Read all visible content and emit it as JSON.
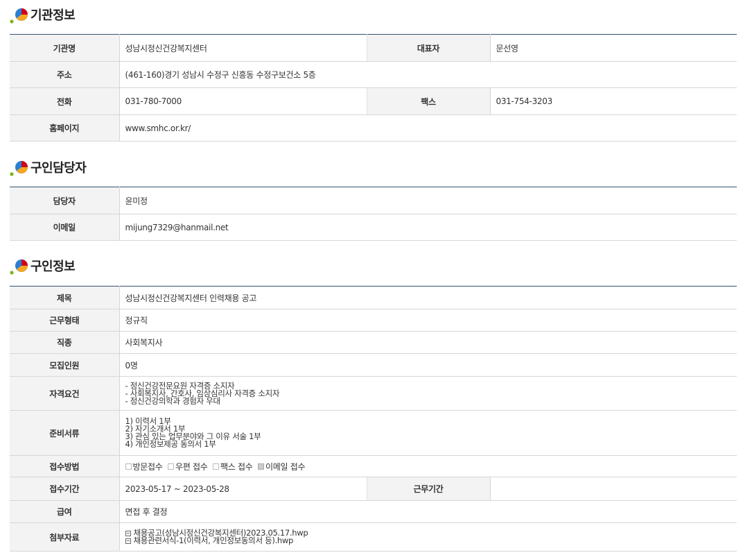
{
  "sections": {
    "org": {
      "title": "기관정보"
    },
    "contact": {
      "title": "구인담당자"
    },
    "job": {
      "title": "구인정보"
    }
  },
  "org": {
    "name_label": "기관명",
    "name": "성남시정신건강복지센터",
    "rep_label": "대표자",
    "rep": "문선영",
    "addr_label": "주소",
    "addr": "(461-160)경기 성남시 수정구 신흥동 수정구보건소 5층",
    "tel_label": "전화",
    "tel": "031-780-7000",
    "fax_label": "팩스",
    "fax": "031-754-3203",
    "home_label": "홈페이지",
    "home": "www.smhc.or.kr/"
  },
  "contact": {
    "person_label": "담당자",
    "person": "윤미정",
    "email_label": "이메일",
    "email": "mijung7329@hanmail.net"
  },
  "job": {
    "title_label": "제목",
    "title": "성남시정신건강복지센터 인력채용 공고",
    "type_label": "근무형태",
    "type": "정규직",
    "occupation_label": "직종",
    "occupation": "사회복지사",
    "count_label": "모집인원",
    "count": "0명",
    "qual_label": "자격요건",
    "qual": [
      " - 정신건강전문요원 자격증 소지자",
      " - 사회복지사, 간호사, 임상심리사  자격증 소지자",
      " - 정신건강의학과 경험자 우대"
    ],
    "docs_label": "준비서류",
    "docs": [
      " 1) 이력서 1부",
      " 2) 자기소개서 1부",
      " 3) 관심 있는 업무분야와 그 이유 서술 1부",
      " 4) 개인정보제공 동의서 1부"
    ],
    "method_label": "접수방법",
    "methods": [
      {
        "label": "방문접수",
        "checked": false
      },
      {
        "label": "우편 접수",
        "checked": false
      },
      {
        "label": "팩스 접수",
        "checked": false
      },
      {
        "label": "이메일 접수",
        "checked": true
      }
    ],
    "period_label": "접수기간",
    "period": "2023-05-17 ~ 2023-05-28",
    "work_period_label": "근무기간",
    "work_period": "",
    "salary_label": "급여",
    "salary": "면접 후 결정",
    "attach_label": "첨부자료",
    "attachments": [
      "채용공고(성남시정신건강복지센터)2023.05.17.hwp",
      "채용관련서식-1(이력서, 개인정보동의서 등).hwp"
    ]
  },
  "colors": {
    "accent_border": "#34506e",
    "label_bg": "#f3f3f3",
    "logo_blue": "#2a7fd4",
    "logo_orange": "#f5a623",
    "logo_red": "#d0021b",
    "logo_green": "#7ab51d"
  }
}
